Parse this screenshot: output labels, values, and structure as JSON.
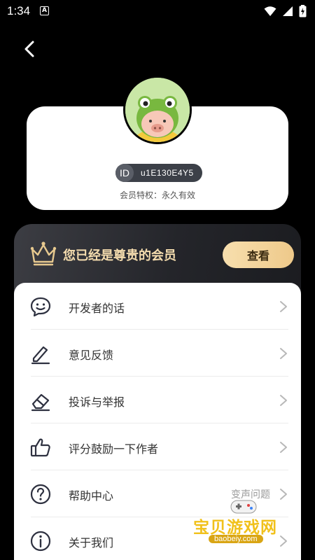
{
  "status_bar": {
    "time": "1:34",
    "app_badge": "A"
  },
  "profile": {
    "id_tag": "ID",
    "id_value": "u1E130E4Y5",
    "privilege": "会员特权：永久有效"
  },
  "vip": {
    "text": "您已经是尊贵的会员",
    "view_button": "查看"
  },
  "menu": {
    "items": [
      {
        "label": "开发者的话",
        "icon": "chat-smile-icon"
      },
      {
        "label": "意见反馈",
        "icon": "pen-icon"
      },
      {
        "label": "投诉与举报",
        "icon": "eraser-icon"
      },
      {
        "label": "评分鼓励一下作者",
        "icon": "thumbs-up-icon"
      },
      {
        "label": "帮助中心",
        "icon": "question-circle-icon",
        "extra": "变声问题"
      },
      {
        "label": "关于我们",
        "icon": "info-circle-icon"
      }
    ]
  },
  "watermark": {
    "text": "宝贝游戏网",
    "url": "baobeiy.com"
  },
  "colors": {
    "background": "#000000",
    "gold": "#f4dcae",
    "button_gold": "#eec98a"
  }
}
